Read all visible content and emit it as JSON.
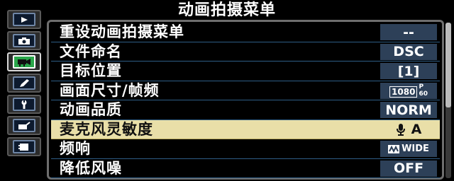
{
  "header": {
    "title": "动画拍摄菜单"
  },
  "tabs": [
    {
      "icon": "playback-icon"
    },
    {
      "icon": "camera-icon"
    },
    {
      "icon": "movie-camera-icon",
      "active": true
    },
    {
      "icon": "pencil-icon"
    },
    {
      "icon": "wrench-icon"
    },
    {
      "icon": "retouch-icon"
    },
    {
      "icon": "my-menu-icon"
    }
  ],
  "menu": {
    "items": [
      {
        "label": "重设动画拍摄菜单",
        "value": "--"
      },
      {
        "label": "文件命名",
        "value": "DSC"
      },
      {
        "label": "目标位置",
        "value": "[1]"
      },
      {
        "label": "画面尺寸/帧频",
        "value_resolution": "1080",
        "value_framerate": "60",
        "value_framerate_prefix": "P"
      },
      {
        "label": "动画品质",
        "value": "NORM"
      },
      {
        "label": "麦克风灵敏度",
        "value": "A",
        "value_icon": "microphone-icon",
        "selected": true
      },
      {
        "label": "频响",
        "value": "WIDE",
        "value_icon": "frequency-response-icon"
      },
      {
        "label": "降低风噪",
        "value": "OFF"
      }
    ]
  },
  "colors": {
    "background": "#000000",
    "row_divider": "#2e5d86",
    "value_box": "#2d4058",
    "selected_row": "#e9dfa8",
    "active_tab": "#2aa64a"
  }
}
